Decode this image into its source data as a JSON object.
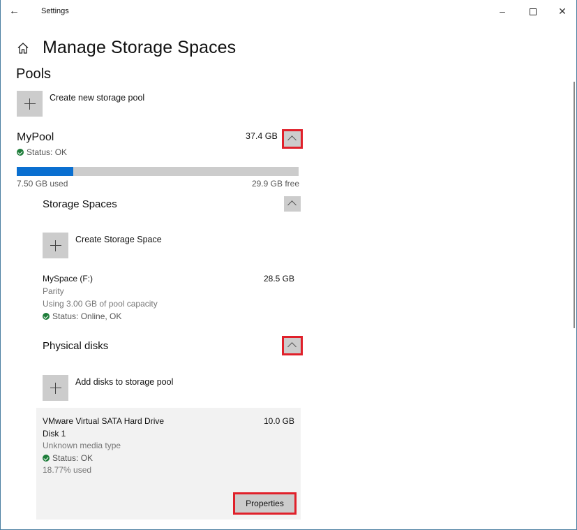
{
  "window": {
    "app_title": "Settings",
    "controls": {
      "minimize": "–",
      "close": "✕"
    }
  },
  "header": {
    "icon": "home-icon",
    "title": "Manage Storage Spaces"
  },
  "pools_section": {
    "title": "Pools",
    "create_pool_label": "Create new storage pool"
  },
  "pool": {
    "name": "MyPool",
    "status": "Status: OK",
    "size": "37.4 GB",
    "used_label": "7.50 GB used",
    "free_label": "29.9 GB free",
    "used_fraction": 0.2,
    "colors": {
      "used": "#0a6fd0",
      "free": "#cccccc",
      "status_ok": "#1e7d3a",
      "highlight": "#e0202a"
    }
  },
  "storage_spaces": {
    "title": "Storage Spaces",
    "create_label": "Create Storage Space",
    "items": [
      {
        "name": "MySpace (F:)",
        "size": "28.5 GB",
        "resiliency": "Parity",
        "usage": "Using 3.00 GB of pool capacity",
        "status": "Status: Online, OK"
      }
    ]
  },
  "physical_disks": {
    "title": "Physical disks",
    "add_label": "Add disks to storage pool",
    "items": [
      {
        "name": "VMware Virtual SATA Hard Drive",
        "disk": "Disk 1",
        "size": "10.0 GB",
        "media_type": "Unknown media type",
        "status": "Status: OK",
        "used": "18.77% used",
        "properties_label": "Properties"
      }
    ]
  }
}
